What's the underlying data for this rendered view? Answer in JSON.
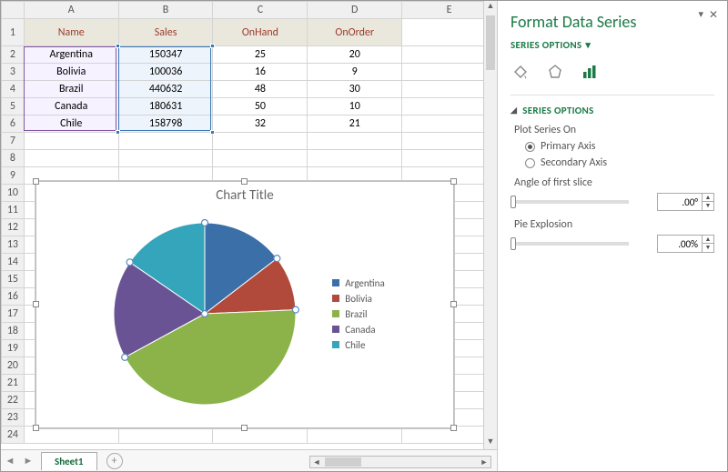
{
  "columns": [
    "A",
    "B",
    "C",
    "D",
    "E"
  ],
  "row_count": 24,
  "table": {
    "headers": {
      "A": "Name",
      "B": "Sales",
      "C": "OnHand",
      "D": "OnOrder"
    },
    "rows": [
      {
        "A": "Argentina",
        "B": "150347",
        "C": "25",
        "D": "20"
      },
      {
        "A": "Bolivia",
        "B": "100036",
        "C": "16",
        "D": "9"
      },
      {
        "A": "Brazil",
        "B": "440632",
        "C": "48",
        "D": "30"
      },
      {
        "A": "Canada",
        "B": "180631",
        "C": "50",
        "D": "10"
      },
      {
        "A": "Chile",
        "B": "158798",
        "C": "32",
        "D": "21"
      }
    ]
  },
  "chart_data": {
    "type": "pie",
    "title": "Chart Title",
    "categories": [
      "Argentina",
      "Bolivia",
      "Brazil",
      "Canada",
      "Chile"
    ],
    "values": [
      150347,
      100036,
      440632,
      180631,
      158798
    ],
    "colors": [
      "#3b6fa8",
      "#b24a3b",
      "#8bb34a",
      "#6a5394",
      "#34a5bb"
    ],
    "legend_position": "right"
  },
  "sheet": {
    "tab": "Sheet1"
  },
  "panel": {
    "title": "Format Data Series",
    "menu": "SERIES OPTIONS",
    "section": "SERIES OPTIONS",
    "plot_label": "Plot Series On",
    "opt_primary": "Primary Axis",
    "opt_secondary": "Secondary Axis",
    "angle_label": "Angle of first slice",
    "angle_value": ".00°",
    "explosion_label": "Pie Explosion",
    "explosion_value": ".00%"
  }
}
